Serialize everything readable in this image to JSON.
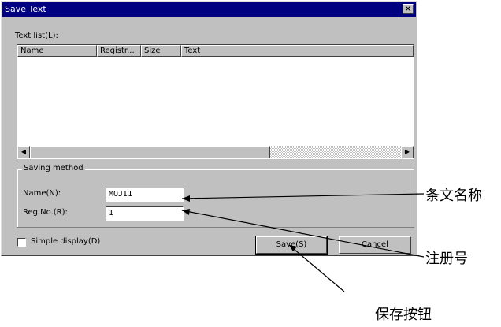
{
  "dialog": {
    "title": "Save Text",
    "close_glyph": "✕",
    "text_list_label": "Text list(L):",
    "columns": [
      "Name",
      "Registr...",
      "Size",
      "Text"
    ],
    "scroll_left_glyph": "◀",
    "scroll_right_glyph": "▶",
    "saving_method_label": "Saving method",
    "name_label": "Name(N):",
    "name_value": "MOJI1",
    "reg_label": "Reg No.(R):",
    "reg_value": "1",
    "simple_display_label": "Simple display(D)",
    "save_label": "Save(S)",
    "cancel_label": "Cancel"
  },
  "annotations": {
    "name_callout": "条文名称",
    "reg_callout": "注册号",
    "save_callout": "保存按钮"
  }
}
